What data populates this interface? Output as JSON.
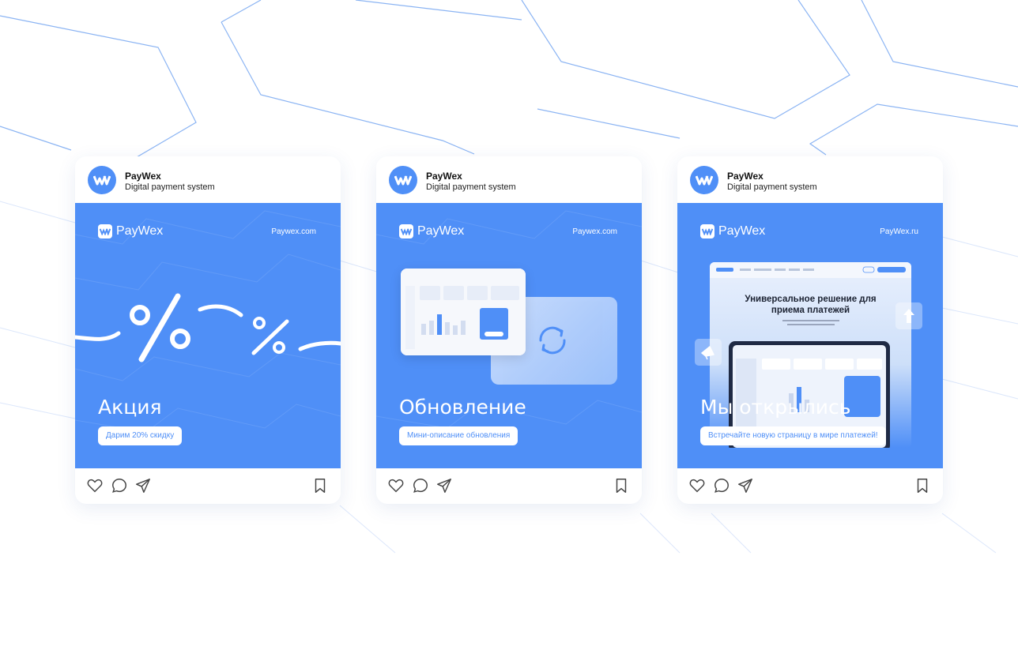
{
  "account": {
    "name": "PayWex",
    "subtitle": "Digital payment system"
  },
  "brand": "PayWex",
  "accent_color": "#4f8ff7",
  "posts": [
    {
      "site": "Paywex.com",
      "title": "Акция",
      "pill": "Дарим 20% скидку",
      "decoration": "percent-signs"
    },
    {
      "site": "Paywex.com",
      "title": "Обновление",
      "pill": "Мини-описание обновления",
      "decoration": "dashboard-mockup-refresh-icon"
    },
    {
      "site": "PayWex.ru",
      "title": "Мы открылись",
      "pill": "Встречайте новую страницу в мире платежей!",
      "decoration": "landing-page-mockup",
      "mockup": {
        "headline_line1": "Универсальное решение для",
        "headline_line2": "приема платежей"
      }
    }
  ],
  "action_icons": [
    "heart-icon",
    "comment-icon",
    "share-icon",
    "bookmark-icon"
  ]
}
